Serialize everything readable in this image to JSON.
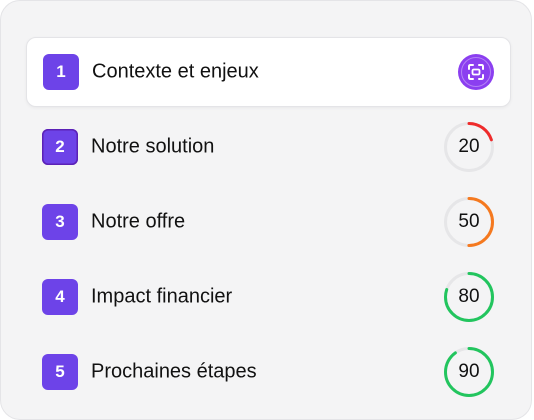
{
  "colors": {
    "accent": "#6d43e8",
    "accent_active_icon": "#8b3ff0",
    "track": "#e6e6e8",
    "red": "#ef2b2b",
    "orange": "#f5791f",
    "green": "#22c55e"
  },
  "steps": [
    {
      "number": "1",
      "label": "Contexte et enjeux",
      "indicator": "focus-icon",
      "active": true
    },
    {
      "number": "2",
      "label": "Notre solution",
      "score": 20,
      "score_label": "20",
      "color": "#ef2b2b"
    },
    {
      "number": "3",
      "label": "Notre offre",
      "score": 50,
      "score_label": "50",
      "color": "#f5791f"
    },
    {
      "number": "4",
      "label": "Impact financier",
      "score": 80,
      "score_label": "80",
      "color": "#22c55e"
    },
    {
      "number": "5",
      "label": "Prochaines étapes",
      "score": 90,
      "score_label": "90",
      "color": "#22c55e"
    }
  ]
}
